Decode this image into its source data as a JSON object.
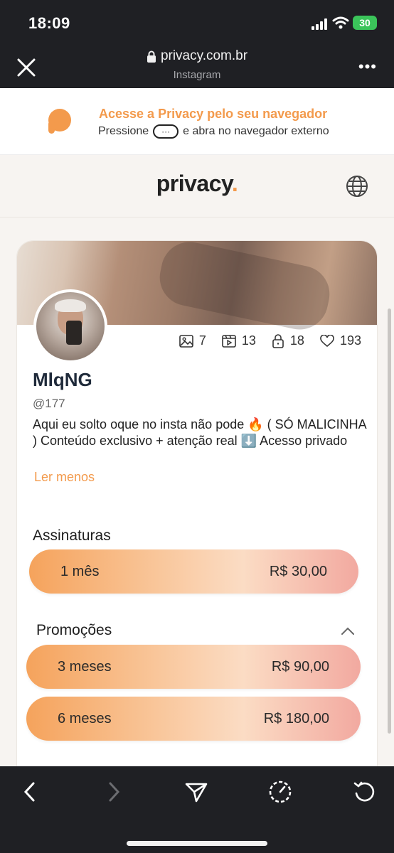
{
  "status": {
    "time": "18:09",
    "battery": "30"
  },
  "browser": {
    "url": "privacy.com.br",
    "source": "Instagram"
  },
  "banner": {
    "title": "Acesse a Privacy pelo seu navegador",
    "pre": "Pressione",
    "post": "e abra no navegador externo"
  },
  "site": {
    "brand": "privacy",
    "brand_dot": "."
  },
  "profile": {
    "name": "MlqNG",
    "handle": "@177",
    "bio": "Aqui eu solto oque no insta não pode 🔥 ( SÓ MALICINHA ) Conteúdo exclusivo + atenção real ⬇️ Acesso privado",
    "read_less": "Ler menos",
    "stats": {
      "photos": "7",
      "videos": "13",
      "locked": "18",
      "likes": "193"
    }
  },
  "subscriptions": {
    "title": "Assinaturas",
    "plans": [
      {
        "label": "1 mês",
        "price": "R$ 30,00"
      }
    ]
  },
  "promotions": {
    "title": "Promoções",
    "plans": [
      {
        "label": "3 meses",
        "price": "R$ 90,00"
      },
      {
        "label": "6 meses",
        "price": "R$ 180,00"
      }
    ]
  },
  "colors": {
    "accent": "#f39a4c",
    "dark_bar": "#1f2024"
  }
}
